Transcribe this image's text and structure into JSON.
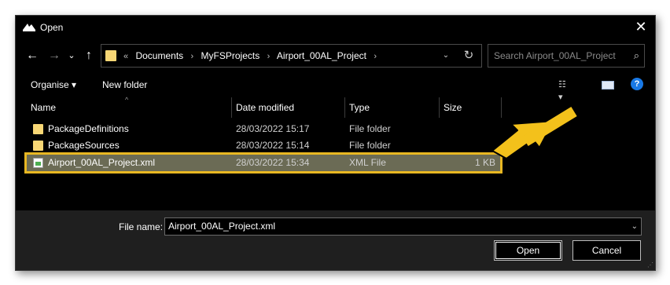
{
  "window": {
    "title": "Open",
    "close_glyph": "✕",
    "app_icon": "title-app-icon"
  },
  "nav": {
    "back_glyph": "←",
    "forward_glyph": "→",
    "recent_glyph": "⌄",
    "up_glyph": "↑",
    "overflow": "«",
    "breadcrumb": [
      "Documents",
      "MyFSProjects",
      "Airport_00AL_Project"
    ],
    "separator": "›",
    "dropdown_glyph": "⌄",
    "refresh_glyph": "↻"
  },
  "search": {
    "placeholder": "Search Airport_00AL_Project",
    "icon_glyph": "⌕"
  },
  "toolbar": {
    "organise_label": "Organise ▾",
    "new_folder_label": "New folder",
    "view_glyph": "☷ ▾",
    "help_glyph": "?"
  },
  "columns": {
    "name": "Name",
    "date": "Date modified",
    "type": "Type",
    "size": "Size",
    "sort_glyph": "^"
  },
  "files": [
    {
      "name": "PackageDefinitions",
      "date": "28/03/2022 15:17",
      "type": "File folder",
      "size": "",
      "icon": "folder-icon"
    },
    {
      "name": "PackageSources",
      "date": "28/03/2022 15:14",
      "type": "File folder",
      "size": "",
      "icon": "folder-icon"
    },
    {
      "name": "Airport_00AL_Project.xml",
      "date": "28/03/2022 15:34",
      "type": "XML File",
      "size": "1 KB",
      "icon": "xml-file-icon",
      "selected": true
    }
  ],
  "footer": {
    "file_name_label": "File name:",
    "file_name_value": "Airport_00AL_Project.xml",
    "file_name_dropdown_glyph": "⌄",
    "open_label": "Open",
    "cancel_label": "Cancel",
    "grip_glyph": "⋰"
  },
  "colors": {
    "background": "#000000",
    "footer": "#1f1f1f",
    "selection": "#6b6b55",
    "highlight": "#e8b722",
    "arrow": "#f3c11b",
    "folder": "#f8d775"
  }
}
